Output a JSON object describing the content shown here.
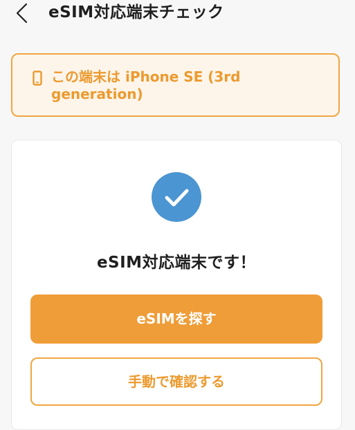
{
  "header": {
    "back_icon": "chevron-left-icon",
    "title": "eSIM対応端末チェック"
  },
  "device_banner": {
    "icon": "smartphone-icon",
    "text": "この端末は iPhone SE (3rd generation)"
  },
  "result": {
    "icon": "check-circle-icon",
    "message": "eSIM対応端末です！"
  },
  "actions": {
    "primary_label": "eSIMを探す",
    "secondary_label": "手動で確認する"
  },
  "colors": {
    "accent": "#ef9d38",
    "accent_text": "#ec9a2f",
    "banner_bg": "#fdf5ea",
    "success": "#4b95d2",
    "background": "#f7f7f7"
  }
}
